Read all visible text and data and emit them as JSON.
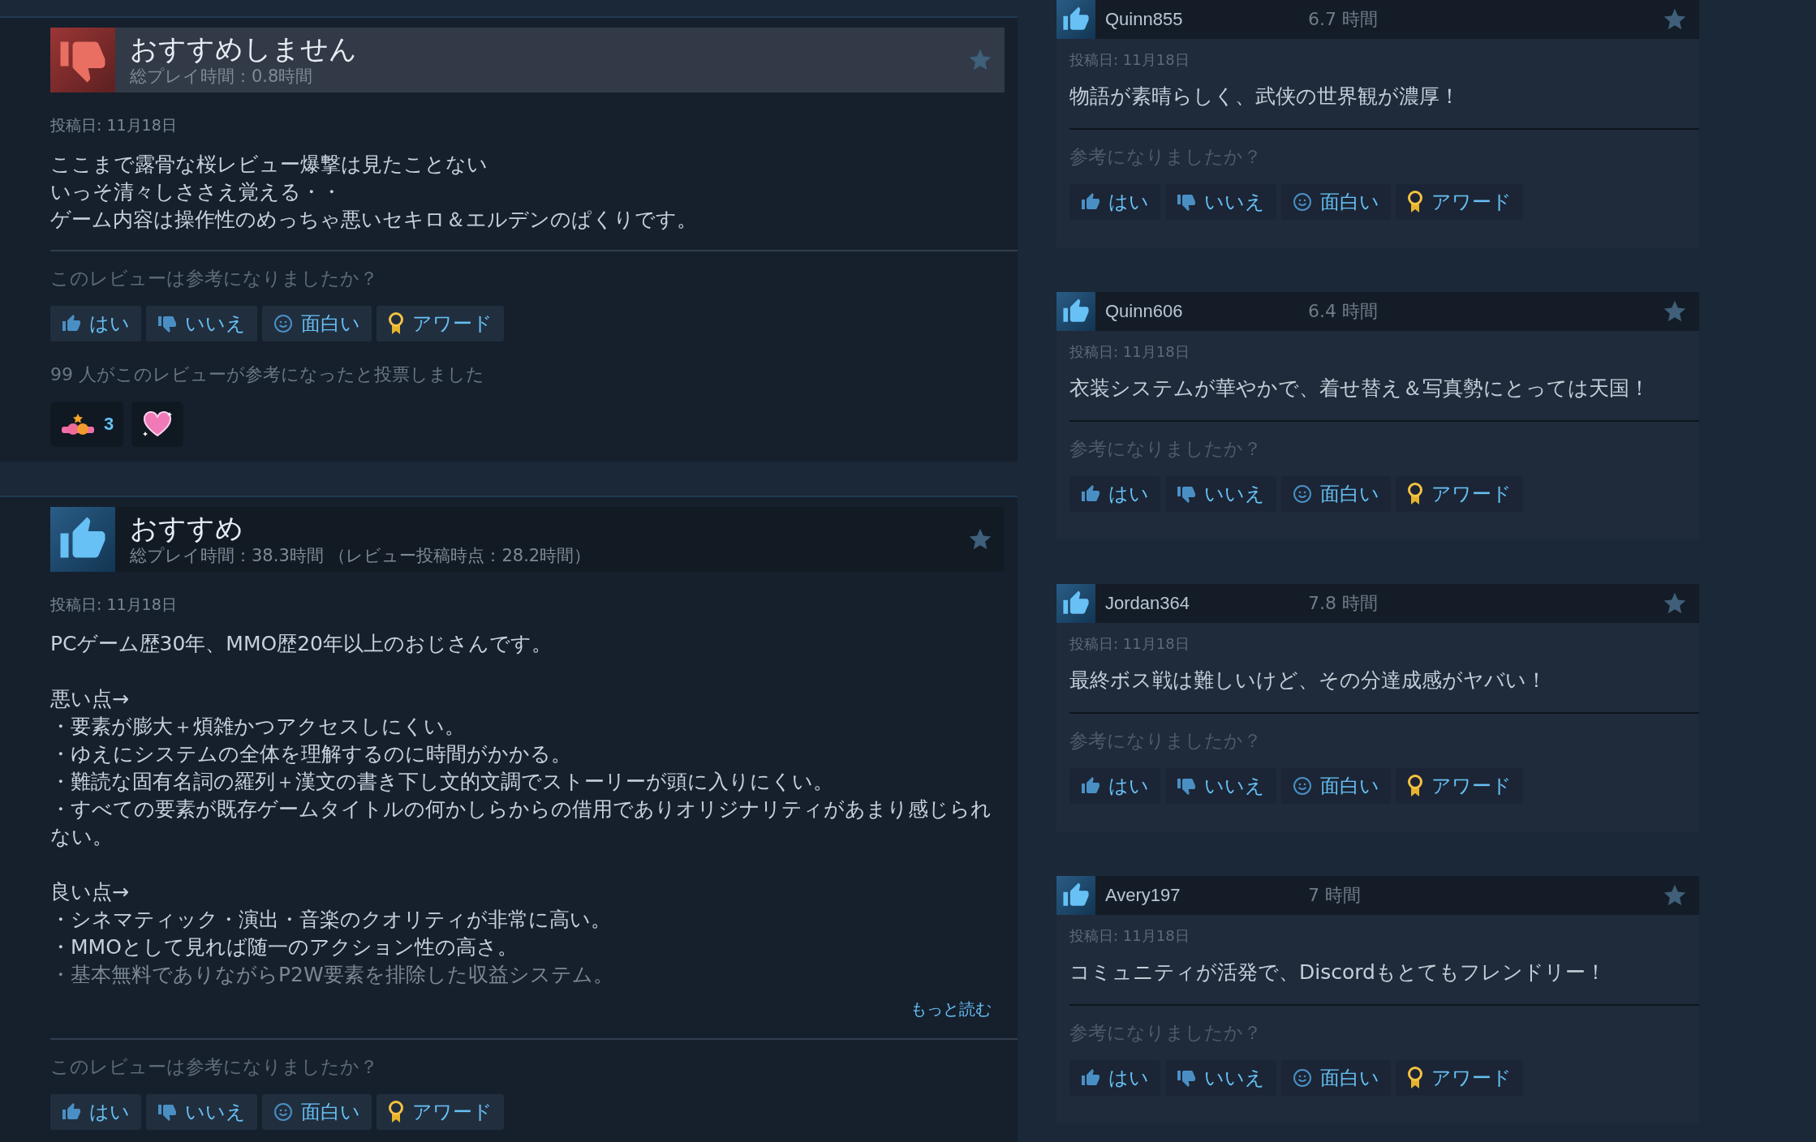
{
  "reviews": [
    {
      "recommended": false,
      "verdict": "おすすめしません",
      "playtime": "総プレイ時間：0.8時間",
      "date": "投稿日: 11月18日",
      "body": [
        [
          "ここまで露骨な桜レビュー爆撃は見たことない",
          "いっそ清々しささえ覚える・・",
          "ゲーム内容は操作性のめっちゃ悪いセキロ＆エルデンのぱくりです。"
        ]
      ],
      "question": "このレビューは参考になりましたか？",
      "buttons": [
        {
          "kind": "yes",
          "label": "はい"
        },
        {
          "kind": "no",
          "label": "いいえ"
        },
        {
          "kind": "funny",
          "label": "面白い"
        },
        {
          "kind": "award",
          "label": "アワード"
        }
      ],
      "votes": "99 人がこのレビューが参考になったと投票しました",
      "reactions": [
        {
          "kind": "gift",
          "count": "3"
        },
        {
          "kind": "heart"
        }
      ]
    },
    {
      "recommended": true,
      "verdict": "おすすめ",
      "playtime": "総プレイ時間：38.3時間 （レビュー投稿時点：28.2時間）",
      "date": "投稿日: 11月18日",
      "body": [
        [
          "PCゲーム歴30年、MMO歴20年以上のおじさんです。"
        ],
        [
          "悪い点→",
          "・要素が膨大＋煩雑かつアクセスしにくい。",
          "・ゆえにシステムの全体を理解するのに時間がかかる。",
          "・難読な固有名詞の羅列＋漢文の書き下し文的文調でストーリーが頭に入りにくい。",
          "・すべての要素が既存ゲームタイトルの何かしらからの借用でありオリジナリティがあまり感じられない。"
        ],
        [
          "良い点→",
          "・シネマティック・演出・音楽のクオリティが非常に高い。",
          "・MMOとして見れば随一のアクション性の高さ。",
          "・基本無料でありながらP2W要素を排除した収益システム。"
        ]
      ],
      "more_link": "もっと読む",
      "question": "このレビューは参考になりましたか？",
      "buttons": [
        {
          "kind": "yes",
          "label": "はい"
        },
        {
          "kind": "no",
          "label": "いいえ"
        },
        {
          "kind": "funny",
          "label": "面白い"
        },
        {
          "kind": "award",
          "label": "アワード"
        }
      ]
    }
  ],
  "side_reviews": [
    {
      "recommended": true,
      "user": "Quinn855",
      "hours": "6.7 時間",
      "date": "投稿日: 11月18日",
      "body": "物語が素晴らしく、武侠の世界観が濃厚！",
      "question": "参考になりましたか？",
      "buttons": [
        {
          "kind": "yes",
          "label": "はい"
        },
        {
          "kind": "no",
          "label": "いいえ"
        },
        {
          "kind": "funny",
          "label": "面白い"
        },
        {
          "kind": "award",
          "label": "アワード"
        }
      ]
    },
    {
      "recommended": true,
      "user": "Quinn606",
      "hours": "6.4 時間",
      "date": "投稿日: 11月18日",
      "body": "衣装システムが華やかで、着せ替え＆写真勢にとっては天国！",
      "question": "参考になりましたか？",
      "buttons": [
        {
          "kind": "yes",
          "label": "はい"
        },
        {
          "kind": "no",
          "label": "いいえ"
        },
        {
          "kind": "funny",
          "label": "面白い"
        },
        {
          "kind": "award",
          "label": "アワード"
        }
      ]
    },
    {
      "recommended": true,
      "user": "Jordan364",
      "hours": "7.8 時間",
      "date": "投稿日: 11月18日",
      "body": "最終ボス戦は難しいけど、その分達成感がヤバい！",
      "question": "参考になりましたか？",
      "buttons": [
        {
          "kind": "yes",
          "label": "はい"
        },
        {
          "kind": "no",
          "label": "いいえ"
        },
        {
          "kind": "funny",
          "label": "面白い"
        },
        {
          "kind": "award",
          "label": "アワード"
        }
      ]
    },
    {
      "recommended": true,
      "user": "Avery197",
      "hours": "7 時間",
      "date": "投稿日: 11月18日",
      "body": "コミュニティが活発で、Discordもとてもフレンドリー！",
      "question": "参考になりましたか？",
      "buttons": [
        {
          "kind": "yes",
          "label": "はい"
        },
        {
          "kind": "no",
          "label": "いいえ"
        },
        {
          "kind": "funny",
          "label": "面白い"
        },
        {
          "kind": "award",
          "label": "アワード"
        }
      ]
    }
  ]
}
